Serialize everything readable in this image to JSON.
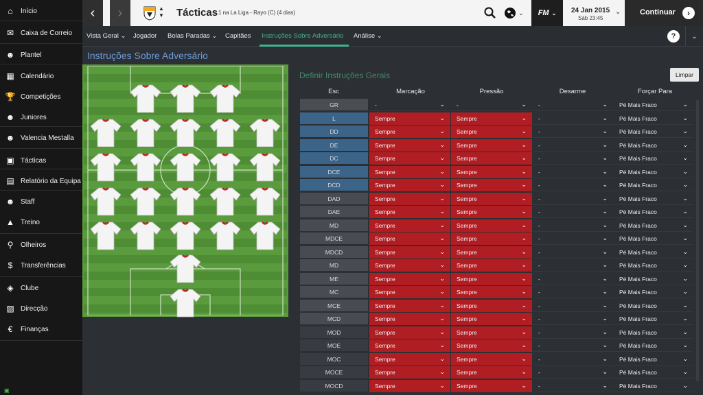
{
  "sidebar": {
    "items": [
      {
        "label": "Início",
        "icon": "home-icon"
      },
      {
        "label": "Caixa de Correio",
        "icon": "inbox-icon"
      },
      {
        "label": "Plantel",
        "icon": "squad-icon"
      },
      {
        "label": "Calendário",
        "icon": "calendar-icon"
      },
      {
        "label": "Competições",
        "icon": "trophy-icon"
      },
      {
        "label": "Juniores",
        "icon": "youth-icon"
      },
      {
        "label": "Valencia Mestalla",
        "icon": "reserve-team-icon"
      },
      {
        "label": "Tácticas",
        "icon": "tactics-icon"
      },
      {
        "label": "Relatório da Equipa",
        "icon": "report-icon"
      },
      {
        "label": "Staff",
        "icon": "staff-icon"
      },
      {
        "label": "Treino",
        "icon": "training-icon"
      },
      {
        "label": "Olheiros",
        "icon": "scouting-icon"
      },
      {
        "label": "Transferências",
        "icon": "transfers-icon"
      },
      {
        "label": "Clube",
        "icon": "club-icon"
      },
      {
        "label": "Direcção",
        "icon": "board-icon"
      },
      {
        "label": "Finanças",
        "icon": "finances-icon"
      }
    ]
  },
  "topbar": {
    "title": "Tácticas",
    "subtitle": "1 na La Liga - Rayo (C) (4 dias)",
    "fm_label": "FM",
    "date": "24 Jan 2015",
    "day_time": "Sáb 23:45",
    "continue_label": "Continuar"
  },
  "subnav": {
    "tabs": [
      {
        "label": "Vista Geral",
        "dropdown": true
      },
      {
        "label": "Jogador",
        "dropdown": false
      },
      {
        "label": "Bolas Paradas",
        "dropdown": true
      },
      {
        "label": "Capitães",
        "dropdown": false
      },
      {
        "label": "Instruções Sobre Adversário",
        "dropdown": false,
        "active": true
      },
      {
        "label": "Análise",
        "dropdown": true
      }
    ],
    "help_label": "?"
  },
  "section_title": "Instruções Sobre Adversário",
  "panel": {
    "title": "Definir Instruções Gerais",
    "clear_label": "Limpar",
    "columns": [
      "Esc",
      "Marcação",
      "Pressão",
      "Desarme",
      "Forçar Para"
    ],
    "rows": [
      {
        "pos": "GR",
        "marking": "-",
        "pressing": "-",
        "tackling": "-",
        "force": "Pé Mais Fraco"
      },
      {
        "pos": "L",
        "marking": "Sempre",
        "pressing": "Sempre",
        "tackling": "-",
        "force": "Pé Mais Fraco"
      },
      {
        "pos": "DD",
        "marking": "Sempre",
        "pressing": "Sempre",
        "tackling": "-",
        "force": "Pé Mais Fraco"
      },
      {
        "pos": "DE",
        "marking": "Sempre",
        "pressing": "Sempre",
        "tackling": "-",
        "force": "Pé Mais Fraco"
      },
      {
        "pos": "DC",
        "marking": "Sempre",
        "pressing": "Sempre",
        "tackling": "-",
        "force": "Pé Mais Fraco"
      },
      {
        "pos": "DCE",
        "marking": "Sempre",
        "pressing": "Sempre",
        "tackling": "-",
        "force": "Pé Mais Fraco"
      },
      {
        "pos": "DCD",
        "marking": "Sempre",
        "pressing": "Sempre",
        "tackling": "-",
        "force": "Pé Mais Fraco"
      },
      {
        "pos": "DAD",
        "marking": "Sempre",
        "pressing": "Sempre",
        "tackling": "-",
        "force": "Pé Mais Fraco"
      },
      {
        "pos": "DAE",
        "marking": "Sempre",
        "pressing": "Sempre",
        "tackling": "-",
        "force": "Pé Mais Fraco"
      },
      {
        "pos": "MD",
        "marking": "Sempre",
        "pressing": "Sempre",
        "tackling": "-",
        "force": "Pé Mais Fraco"
      },
      {
        "pos": "MDCE",
        "marking": "Sempre",
        "pressing": "Sempre",
        "tackling": "-",
        "force": "Pé Mais Fraco"
      },
      {
        "pos": "MDCD",
        "marking": "Sempre",
        "pressing": "Sempre",
        "tackling": "-",
        "force": "Pé Mais Fraco"
      },
      {
        "pos": "MD",
        "marking": "Sempre",
        "pressing": "Sempre",
        "tackling": "-",
        "force": "Pé Mais Fraco"
      },
      {
        "pos": "ME",
        "marking": "Sempre",
        "pressing": "Sempre",
        "tackling": "-",
        "force": "Pé Mais Fraco"
      },
      {
        "pos": "MC",
        "marking": "Sempre",
        "pressing": "Sempre",
        "tackling": "-",
        "force": "Pé Mais Fraco"
      },
      {
        "pos": "MCE",
        "marking": "Sempre",
        "pressing": "Sempre",
        "tackling": "-",
        "force": "Pé Mais Fraco"
      },
      {
        "pos": "MCD",
        "marking": "Sempre",
        "pressing": "Sempre",
        "tackling": "-",
        "force": "Pé Mais Fraco"
      },
      {
        "pos": "MOD",
        "marking": "Sempre",
        "pressing": "Sempre",
        "tackling": "-",
        "force": "Pé Mais Fraco"
      },
      {
        "pos": "MOE",
        "marking": "Sempre",
        "pressing": "Sempre",
        "tackling": "-",
        "force": "Pé Mais Fraco"
      },
      {
        "pos": "MOC",
        "marking": "Sempre",
        "pressing": "Sempre",
        "tackling": "-",
        "force": "Pé Mais Fraco"
      },
      {
        "pos": "MOCE",
        "marking": "Sempre",
        "pressing": "Sempre",
        "tackling": "-",
        "force": "Pé Mais Fraco"
      },
      {
        "pos": "MOCD",
        "marking": "Sempre",
        "pressing": "Sempre",
        "tackling": "-",
        "force": "Pé Mais Fraco"
      }
    ]
  },
  "colors": {
    "accent": "#3fb58a",
    "section_title": "#6b9ad6",
    "cell_red": "#b01e24",
    "pitch_green": "#5a9b3d"
  }
}
